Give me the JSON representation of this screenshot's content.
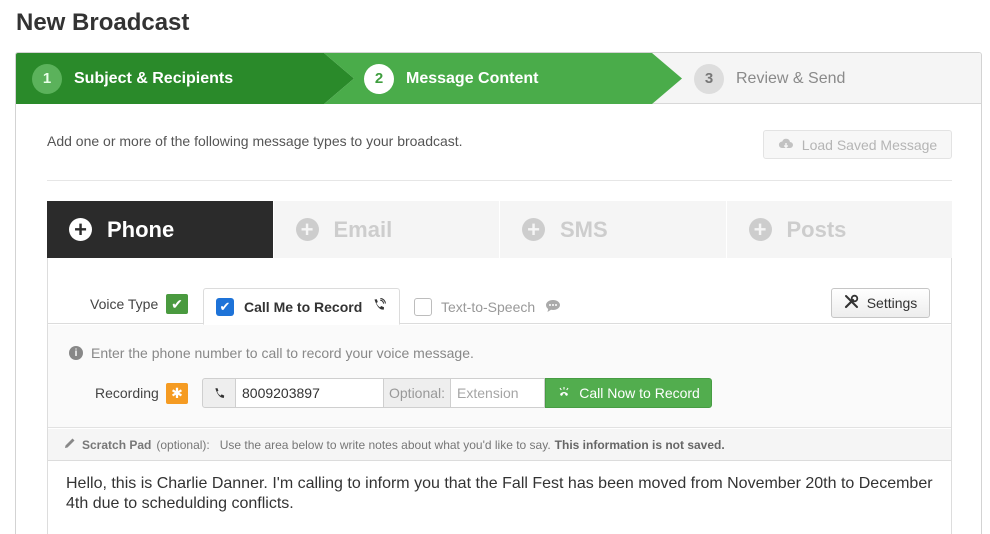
{
  "page": {
    "title": "New Broadcast"
  },
  "steps": [
    {
      "number": "1",
      "label": "Subject & Recipients"
    },
    {
      "number": "2",
      "label": "Message Content"
    },
    {
      "number": "3",
      "label": "Review & Send"
    }
  ],
  "content": {
    "intro": "Add one or more of the following message types to your broadcast.",
    "load_saved_label": "Load Saved Message"
  },
  "message_tabs": [
    {
      "label": "Phone",
      "active": true
    },
    {
      "label": "Email",
      "active": false
    },
    {
      "label": "SMS",
      "active": false
    },
    {
      "label": "Posts",
      "active": false
    }
  ],
  "voice": {
    "type_label": "Voice Type",
    "options": [
      {
        "label": "Call Me to Record",
        "checked": true
      },
      {
        "label": "Text-to-Speech",
        "checked": false
      }
    ],
    "settings_label": "Settings"
  },
  "recording": {
    "info": "Enter the phone number to call to record your voice message.",
    "label": "Recording",
    "phone_value": "8009203897",
    "optional_label": "Optional:",
    "extension_placeholder": "Extension",
    "call_button_label": "Call Now to Record"
  },
  "scratch_pad": {
    "title": "Scratch Pad",
    "optional": "(optional):",
    "description": "Use the area below to write notes about what you'd like to say.",
    "note": "This information is not saved.",
    "text": "Hello, this is Charlie Danner. I'm calling to inform you that the Fall Fest has been moved from November 20th to December 4th due to schedulding conflicts."
  },
  "colors": {
    "step_done": "#2a8a2a",
    "step_active": "#4aac4a",
    "tab_active": "#2b2b2b",
    "call_button": "#52ad4e",
    "required_badge": "#f59b22",
    "checkbox_checked": "#1e73d8"
  }
}
